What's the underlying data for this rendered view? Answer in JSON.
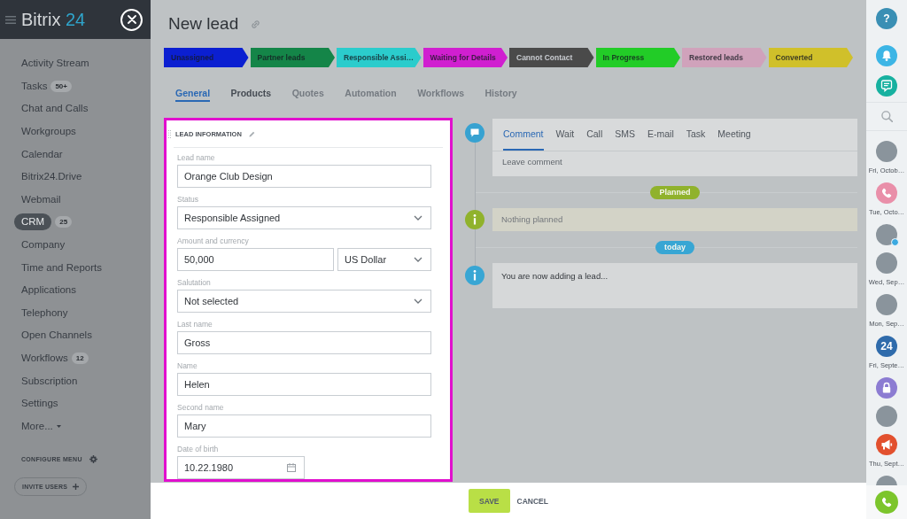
{
  "sidebar": {
    "logo": {
      "name": "Bitrix",
      "number": "24"
    },
    "items": [
      {
        "label": "Activity Stream",
        "selected": false
      },
      {
        "label": "Tasks",
        "counter": "50+",
        "selected": false
      },
      {
        "label": "Chat and Calls",
        "selected": false
      },
      {
        "label": "Workgroups",
        "selected": false
      },
      {
        "label": "Calendar",
        "selected": false
      },
      {
        "label": "Bitrix24.Drive",
        "selected": false
      },
      {
        "label": "Webmail",
        "selected": false
      },
      {
        "label": "CRM",
        "counter": "25",
        "selected": true
      },
      {
        "label": "Company",
        "selected": false
      },
      {
        "label": "Time and Reports",
        "selected": false
      },
      {
        "label": "Applications",
        "selected": false
      },
      {
        "label": "Telephony",
        "selected": false
      },
      {
        "label": "Open Channels",
        "selected": false
      },
      {
        "label": "Workflows",
        "counter": "12",
        "selected": false
      },
      {
        "label": "Subscription",
        "selected": false
      },
      {
        "label": "Settings",
        "selected": false
      }
    ],
    "more": "More...",
    "configure": "CONFIGURE MENU",
    "invite": "INVITE USERS"
  },
  "page": {
    "title": "New lead"
  },
  "stages": [
    {
      "label": "Unassigned",
      "color": "#0b1fd1"
    },
    {
      "label": "Partner leads",
      "color": "#148548"
    },
    {
      "label": "Responsible Assi…",
      "color": "#2bcccc"
    },
    {
      "label": "Waiting for Details",
      "color": "#d01fd0"
    },
    {
      "label": "Cannot Contact",
      "color": "#4a4a4a"
    },
    {
      "label": "In Progress",
      "color": "#22cc27"
    },
    {
      "label": "Restored leads",
      "color": "#d0a2bb"
    },
    {
      "label": "Converted",
      "color": "#d0c02a"
    }
  ],
  "tabs": [
    {
      "label": "General",
      "selected": true,
      "disabled": false
    },
    {
      "label": "Products",
      "selected": false,
      "disabled": false
    },
    {
      "label": "Quotes",
      "selected": false,
      "disabled": true
    },
    {
      "label": "Automation",
      "selected": false,
      "disabled": true
    },
    {
      "label": "Workflows",
      "selected": false,
      "disabled": true
    },
    {
      "label": "History",
      "selected": false,
      "disabled": true
    }
  ],
  "lead_form": {
    "title": "LEAD INFORMATION",
    "fields": [
      {
        "label": "Lead name",
        "kind": "text",
        "value": "Orange Club Design"
      },
      {
        "label": "Status",
        "kind": "select",
        "value": "Responsible Assigned"
      },
      {
        "label": "Amount and currency",
        "kind": "money",
        "value": "50,000",
        "currency": "US Dollar"
      },
      {
        "label": "Salutation",
        "kind": "select",
        "value": "Not selected"
      },
      {
        "label": "Last name",
        "kind": "text",
        "value": "Gross"
      },
      {
        "label": "Name",
        "kind": "text",
        "value": "Helen"
      },
      {
        "label": "Second name",
        "kind": "text",
        "value": "Mary"
      },
      {
        "label": "Date of birth",
        "kind": "date",
        "value": "10.22.1980"
      }
    ]
  },
  "timeline": {
    "tabs": [
      {
        "label": "Comment",
        "selected": true
      },
      {
        "label": "Wait",
        "selected": false
      },
      {
        "label": "Call",
        "selected": false
      },
      {
        "label": "SMS",
        "selected": false
      },
      {
        "label": "E-mail",
        "selected": false
      },
      {
        "label": "Task",
        "selected": false
      },
      {
        "label": "Meeting",
        "selected": false
      }
    ],
    "editor": {
      "placeholder": "Leave comment"
    },
    "entries": [
      {
        "kind": "badge",
        "label": "Planned",
        "color": "#90b22c"
      },
      {
        "kind": "empty",
        "text": "Nothing planned",
        "color": "#90b22c"
      },
      {
        "kind": "badge",
        "label": "today",
        "color": "#38a6d4"
      },
      {
        "kind": "info",
        "text": "You are now adding a lead...",
        "color": "#38a6d4"
      }
    ]
  },
  "footer": {
    "buttons": [
      {
        "label": "SAVE",
        "kind": "primary"
      },
      {
        "label": "CANCEL",
        "kind": "link"
      }
    ]
  },
  "right_bar": {
    "help": "?",
    "contacts": [
      {
        "kind": "photo",
        "caption": "Fri, Octob…",
        "badge": false
      },
      {
        "kind": "call",
        "caption": "Tue, Octo…",
        "badge": false
      },
      {
        "kind": "photo",
        "badge": true
      },
      {
        "kind": "photo",
        "caption": "Wed, Sep…",
        "badge": false
      },
      {
        "kind": "photo",
        "caption": "Mon, Sep…",
        "badge": false
      },
      {
        "kind": "logo",
        "text": "24",
        "caption": "Fri, Septe…",
        "badge": false
      },
      {
        "kind": "lock",
        "badge": false
      },
      {
        "kind": "photo",
        "badge": false
      },
      {
        "kind": "megaphone",
        "caption": "Thu, Sept…",
        "badge": false
      },
      {
        "kind": "photo",
        "badge": false
      }
    ]
  }
}
